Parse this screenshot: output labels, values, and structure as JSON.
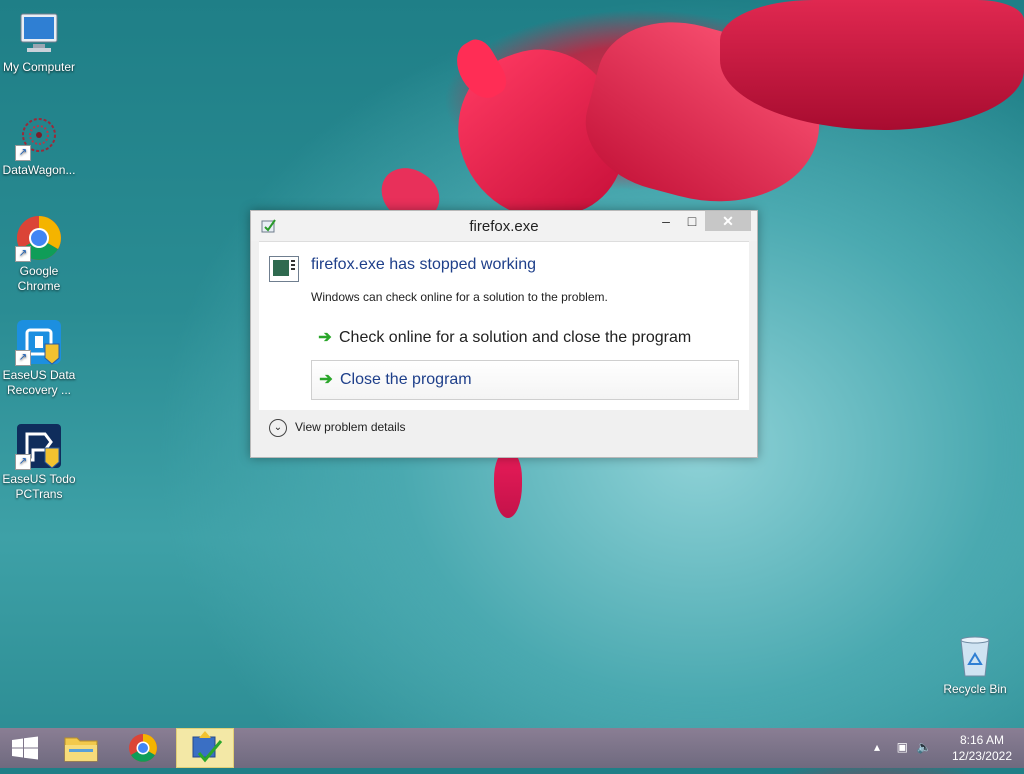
{
  "desktop": {
    "icons": [
      {
        "label": "My Computer"
      },
      {
        "label": "DataWagon..."
      },
      {
        "label": "Google\nChrome"
      },
      {
        "label": "EaseUS Data\nRecovery ..."
      },
      {
        "label": "EaseUS Todo\nPCTrans"
      },
      {
        "label": "Recycle Bin"
      }
    ]
  },
  "dialog": {
    "title": "firefox.exe",
    "heading": "firefox.exe has stopped working",
    "subtext": "Windows can check online for a solution to the problem.",
    "option_check": "Check online for a solution and close the program",
    "option_close": "Close the program",
    "view_details": "View problem details",
    "min_glyph": "–",
    "max_glyph": "□",
    "close_glyph": "✕"
  },
  "taskbar": {
    "time": "8:16 AM",
    "date": "12/23/2022"
  },
  "colors": {
    "link_blue": "#1e3f8a",
    "arrow_green": "#2aa62a",
    "taskbar": "#7a7288"
  }
}
